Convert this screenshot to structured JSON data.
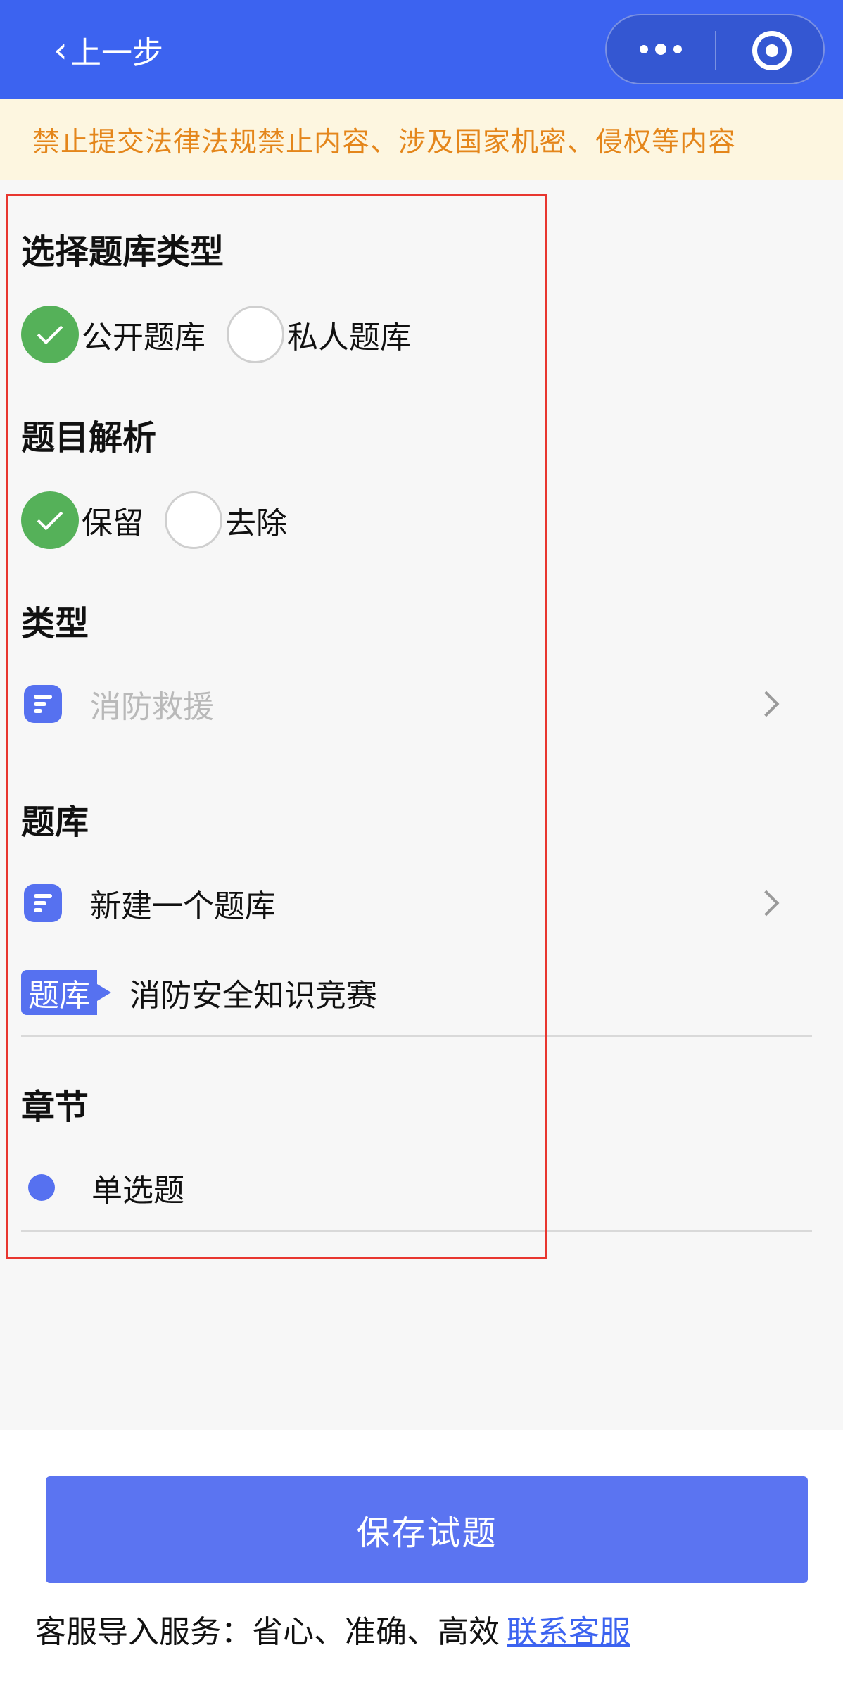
{
  "nav": {
    "back_icon": "‹",
    "back_label": "上一步",
    "capsule_more_icon": "more-dots-icon",
    "capsule_close_icon": "target-icon"
  },
  "notice": {
    "text": "禁止提交法律法规禁止内容、涉及国家机密、侵权等内容",
    "color": "#e4861b",
    "background": "#fdf6e0"
  },
  "bank_type": {
    "title": "选择题库类型",
    "options": [
      {
        "label": "公开题库",
        "checked": true
      },
      {
        "label": "私人题库",
        "checked": false
      }
    ]
  },
  "analysis": {
    "title": "题目解析",
    "options": [
      {
        "label": "保留",
        "checked": true
      },
      {
        "label": "去除",
        "checked": false
      }
    ]
  },
  "category": {
    "title": "类型",
    "placeholder": "消防救援"
  },
  "question_bank": {
    "title": "题库",
    "new_label": "新建一个题库",
    "tag": "题库",
    "selected_name": "消防安全知识竞赛"
  },
  "chapter": {
    "title": "章节",
    "item": "单选题"
  },
  "footer": {
    "save_label": "保存试题",
    "service_text": "客服导入服务：省心、准确、高效",
    "service_link": "联系客服"
  },
  "colors": {
    "primary": "#3c63f0",
    "accent": "#5671f0",
    "checked": "#55b159",
    "annotation": "#e8362f"
  }
}
